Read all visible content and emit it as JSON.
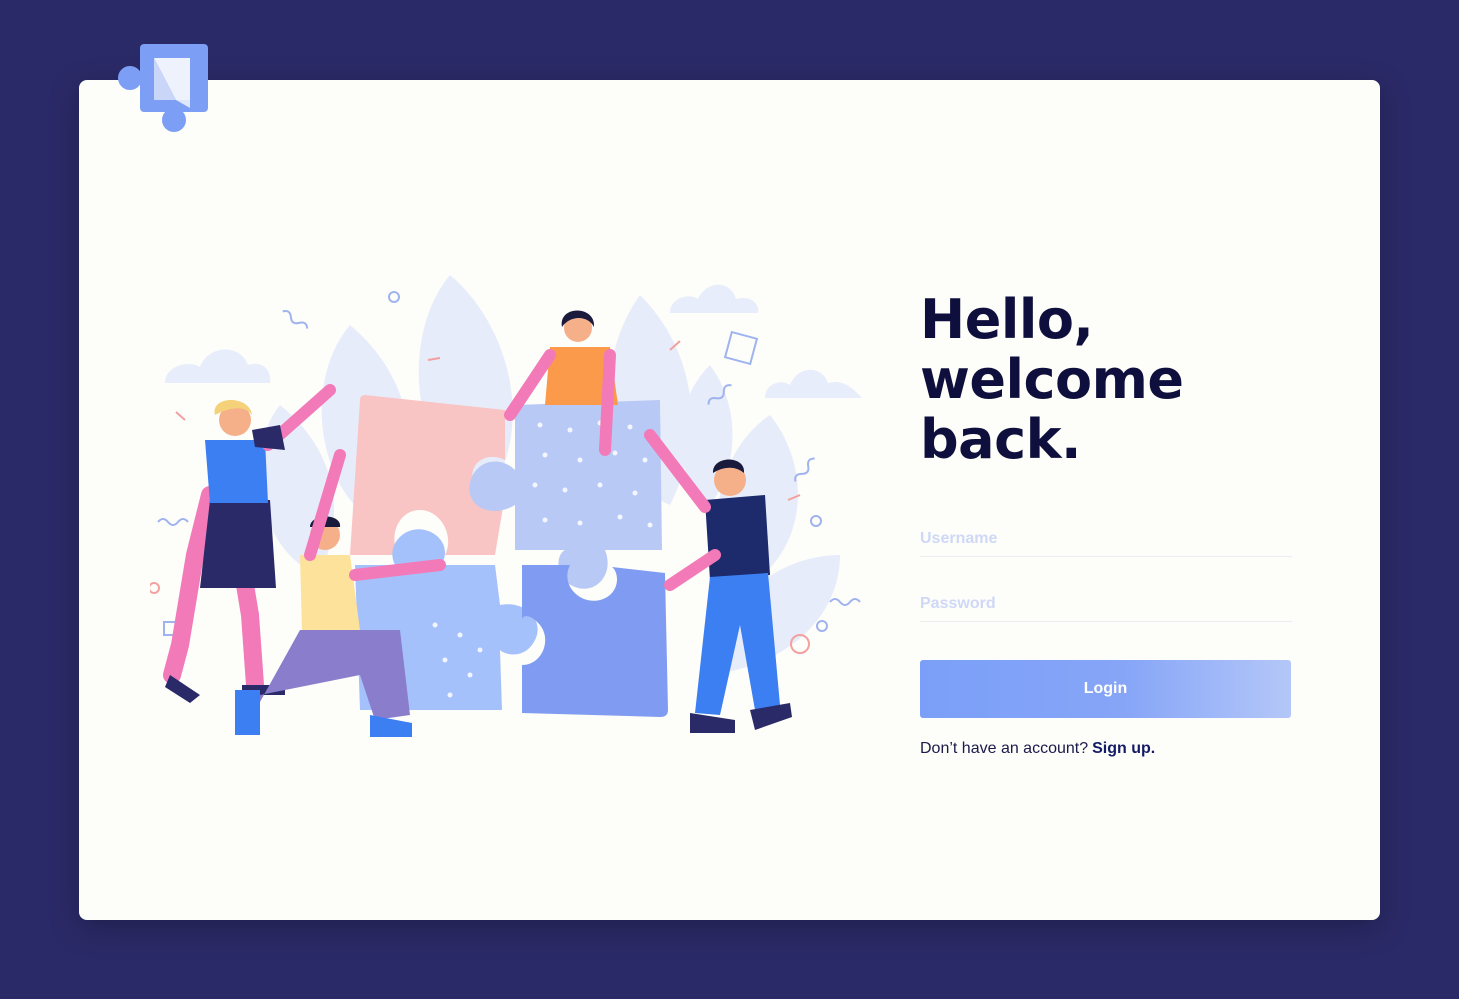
{
  "greeting": {
    "line1": "Hello,",
    "line2": "welcome back."
  },
  "form": {
    "username_placeholder": "Username",
    "password_placeholder": "Password",
    "login_label": "Login",
    "signup_prompt": "Don’t have an account?",
    "signup_link": "Sign up."
  },
  "colors": {
    "background": "#2b2a68",
    "card": "#fdfdf9",
    "heading": "#0f0f3d",
    "button_start": "#7b9ff8",
    "button_end": "#b4c7f8",
    "logo": "#7d9ef5"
  },
  "icons": {
    "logo": "puzzle-logo-icon",
    "illustration": "team-puzzle-illustration"
  }
}
